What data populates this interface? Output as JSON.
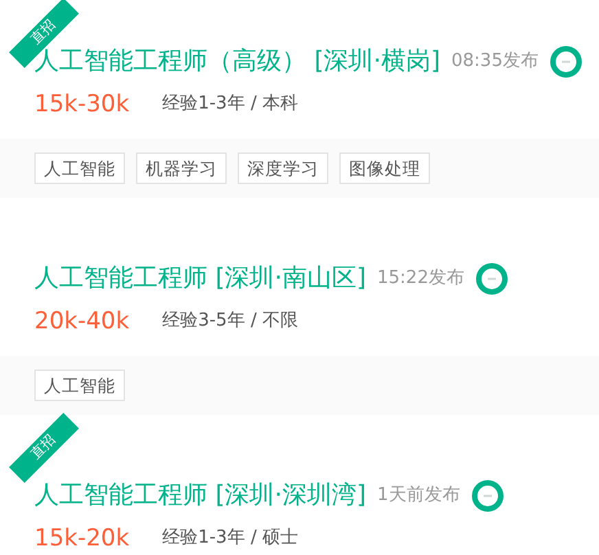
{
  "jobs": [
    {
      "badge": "直招",
      "title": "人工智能工程师（高级） [深圳·横岗]",
      "time": "08:35发布",
      "salary": "15k-30k",
      "requirements": "经验1-3年 / 本科",
      "tags": [
        "人工智能",
        "机器学习",
        "深度学习",
        "图像处理"
      ]
    },
    {
      "title": "人工智能工程师 [深圳·南山区]",
      "time": "15:22发布",
      "salary": "20k-40k",
      "requirements": "经验3-5年 / 不限",
      "tags": [
        "人工智能"
      ]
    },
    {
      "badge": "直招",
      "title": "人工智能工程师 [深圳·深圳湾]",
      "time": "1天前发布",
      "salary": "15k-20k",
      "requirements": "经验1-3年 / 硕士"
    }
  ]
}
